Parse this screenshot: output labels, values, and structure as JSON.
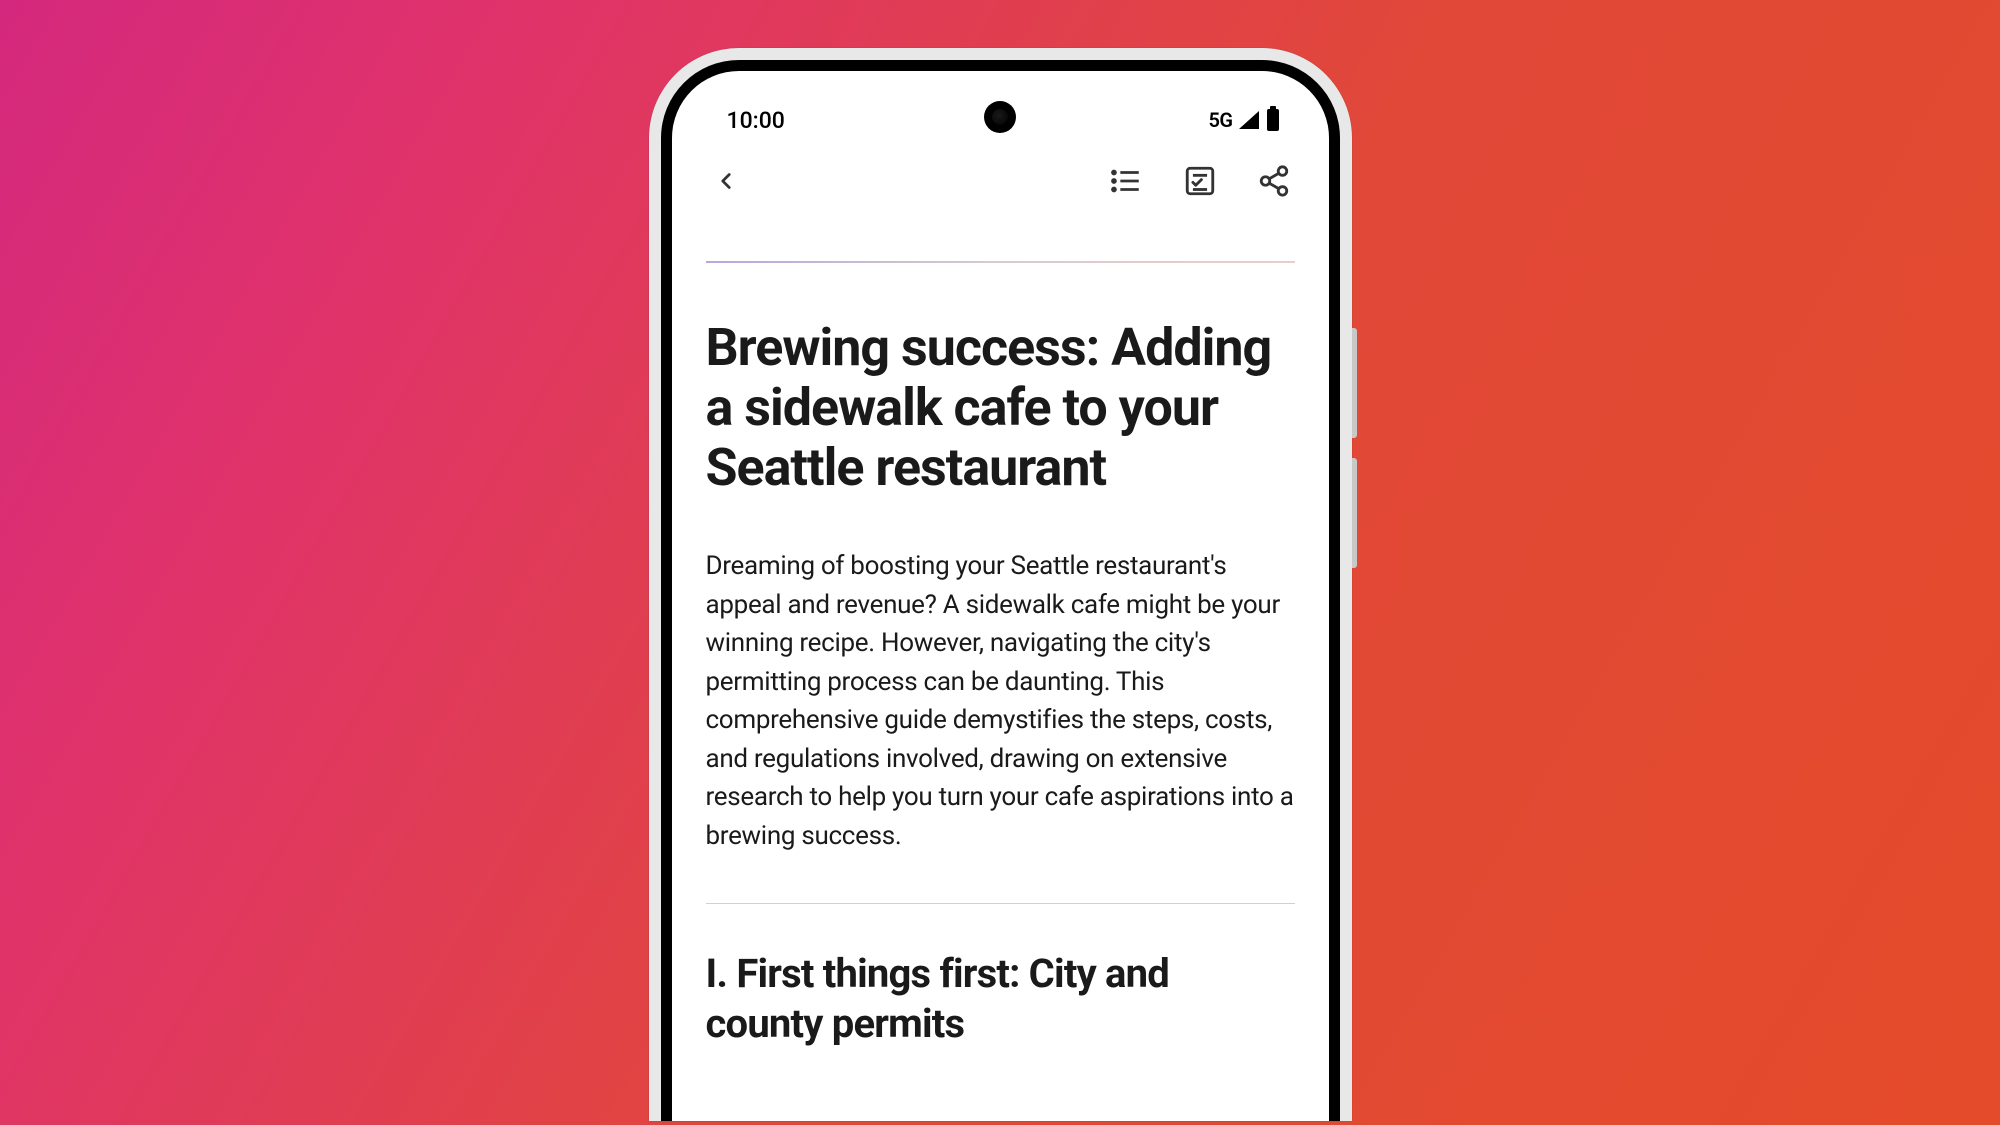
{
  "status_bar": {
    "time": "10:00",
    "network": "5G"
  },
  "toolbar": {
    "back": "Back",
    "list": "List",
    "checklist": "Checklist",
    "share": "Share"
  },
  "article": {
    "title": "Brewing success: Adding a sidewalk cafe to your Seattle restaurant",
    "intro": "Dreaming of boosting your Seattle restaurant's appeal and revenue? A sidewalk cafe might be your winning recipe. However, navigating the city's permitting process can be daunting. This comprehensive guide demystifies the steps, costs, and regulations involved, drawing on extensive research to help you turn your cafe aspirations into a brewing success.",
    "section1_heading": "I. First things first: City and county permits"
  }
}
